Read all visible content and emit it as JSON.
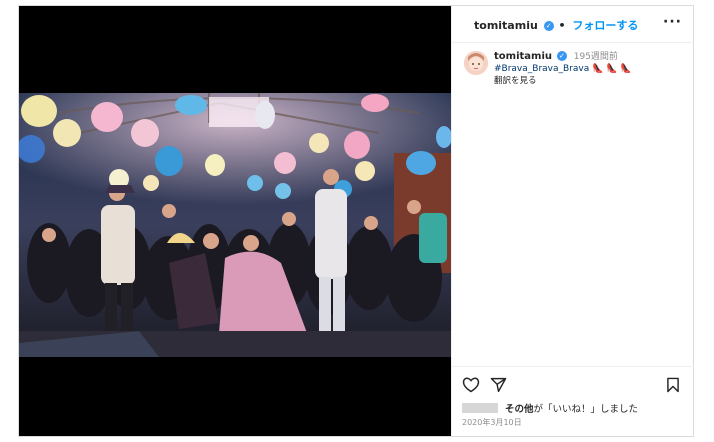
{
  "header": {
    "username": "tomitamiu",
    "separator": "•",
    "follow_label": "フォローする",
    "more_label": "···",
    "verified_glyph": "✓"
  },
  "caption": {
    "username": "tomitamiu",
    "time_ago": "195週間前",
    "hashtag": "#Brava_Brava_Brava",
    "emoji": "👠 👠 👠",
    "translation_label": "翻訳を見る"
  },
  "likes": {
    "suffix_bold": "その他",
    "suffix_text": "が「いいね！」しました"
  },
  "post_date": "2020年3月10日",
  "icons": {
    "like": "heart-icon",
    "share": "send-icon",
    "save": "bookmark-icon",
    "more": "more-icon"
  },
  "colors": {
    "accent": "#0095f6",
    "verified": "#3897f0",
    "border": "#dbdbdb"
  }
}
